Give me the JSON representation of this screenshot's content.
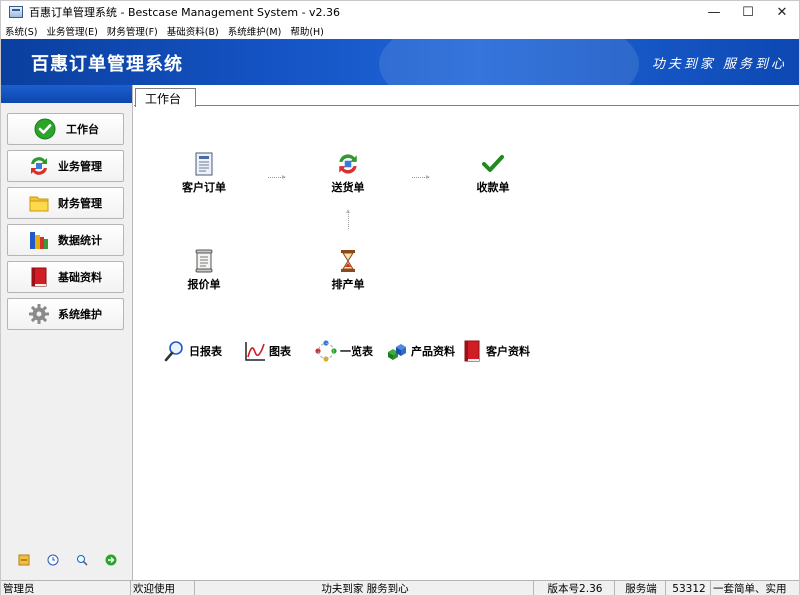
{
  "window": {
    "title": "百惠订单管理系统 - Bestcase Management System - v2.36",
    "controls": {
      "minimize": "—",
      "maximize": "☐",
      "close": "✕"
    }
  },
  "menu": [
    "系统(S)",
    "业务管理(E)",
    "财务管理(F)",
    "基础资料(B)",
    "系统维护(M)",
    "帮助(H)"
  ],
  "banner": {
    "title": "百惠订单管理系统",
    "slogan": "功夫到家  服务到心"
  },
  "sidebar": {
    "items": [
      {
        "label": "工作台",
        "icon": "check-circle-icon"
      },
      {
        "label": "业务管理",
        "icon": "refresh-arrows-icon"
      },
      {
        "label": "财务管理",
        "icon": "folder-icon"
      },
      {
        "label": "数据统计",
        "icon": "books-icon"
      },
      {
        "label": "基础资料",
        "icon": "red-book-icon"
      },
      {
        "label": "系统维护",
        "icon": "gear-icon"
      }
    ],
    "tools": [
      "key-icon",
      "clock-icon",
      "search-icon",
      "green-arrow-icon"
    ]
  },
  "tabs": [
    {
      "label": "工作台"
    }
  ],
  "workflow": {
    "customer_order": "客户订单",
    "delivery": "送货单",
    "receipt": "收款单",
    "quotation": "报价单",
    "production": "排产单"
  },
  "reports": {
    "daily": "日报表",
    "chart": "图表",
    "overview": "一览表",
    "product_info": "产品资料",
    "customer_info": "客户资料"
  },
  "status": {
    "user": "管理员",
    "welcome": "欢迎使用",
    "slogan": "功夫到家 服务到心",
    "version": "版本号2.36",
    "mode": "服务端",
    "port": "53312",
    "tagline": "一套简单、实用"
  },
  "colors": {
    "banner": "#1554c5",
    "accent_green": "#2aa52a",
    "accent_red": "#d01e24"
  }
}
